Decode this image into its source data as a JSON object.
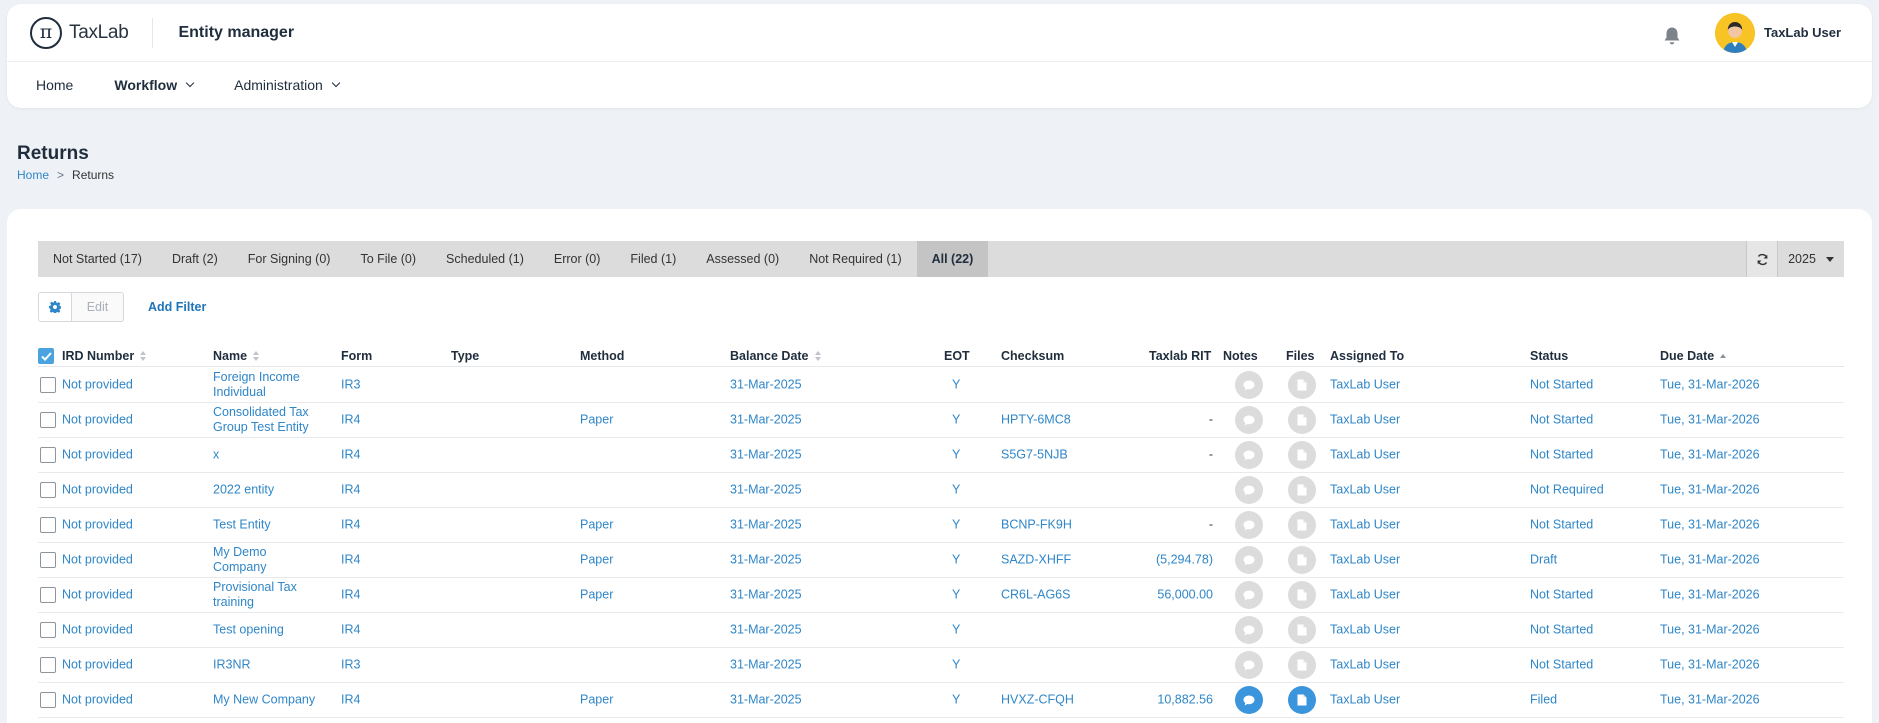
{
  "app": {
    "logo_text": "TaxLab",
    "title": "Entity manager",
    "user_name": "TaxLab User"
  },
  "nav": {
    "home": "Home",
    "workflow": "Workflow",
    "administration": "Administration"
  },
  "page": {
    "title": "Returns"
  },
  "breadcrumb": {
    "home": "Home",
    "separator": ">",
    "current": "Returns"
  },
  "tabs": [
    {
      "label": "Not Started (17)"
    },
    {
      "label": "Draft (2)"
    },
    {
      "label": "For Signing (0)"
    },
    {
      "label": "To File (0)"
    },
    {
      "label": "Scheduled (1)"
    },
    {
      "label": "Error (0)"
    },
    {
      "label": "Filed (1)"
    },
    {
      "label": "Assessed (0)"
    },
    {
      "label": "Not Required (1)"
    },
    {
      "label": "All (22)",
      "active": true
    }
  ],
  "year": "2025",
  "toolbar": {
    "edit_label": "Edit",
    "add_filter_label": "Add Filter"
  },
  "columns": {
    "ird": "IRD Number",
    "name": "Name",
    "form": "Form",
    "type": "Type",
    "method": "Method",
    "balance_date": "Balance Date",
    "eot": "EOT",
    "checksum": "Checksum",
    "rit": "Taxlab RIT",
    "notes": "Notes",
    "files": "Files",
    "assigned": "Assigned To",
    "status": "Status",
    "due": "Due Date"
  },
  "rows": [
    {
      "ird": "Not provided",
      "name": "Foreign Income Individual",
      "form": "IR3",
      "type": "",
      "method": "",
      "balance_date": "31-Mar-2025",
      "eot": "Y",
      "checksum": "",
      "rit": "",
      "assigned": "TaxLab User",
      "status": "Not Started",
      "due": "Tue, 31-Mar-2026"
    },
    {
      "ird": "Not provided",
      "name": "Consolidated Tax Group Test Entity",
      "form": "IR4",
      "type": "",
      "method": "Paper",
      "balance_date": "31-Mar-2025",
      "eot": "Y",
      "checksum": "HPTY-6MC8",
      "rit": "-",
      "assigned": "TaxLab User",
      "status": "Not Started",
      "due": "Tue, 31-Mar-2026"
    },
    {
      "ird": "Not provided",
      "name": "x",
      "form": "IR4",
      "type": "",
      "method": "",
      "balance_date": "31-Mar-2025",
      "eot": "Y",
      "checksum": "S5G7-5NJB",
      "rit": "-",
      "assigned": "TaxLab User",
      "status": "Not Started",
      "due": "Tue, 31-Mar-2026"
    },
    {
      "ird": "Not provided",
      "name": "2022 entity",
      "form": "IR4",
      "type": "",
      "method": "",
      "balance_date": "31-Mar-2025",
      "eot": "Y",
      "checksum": "",
      "rit": "",
      "assigned": "TaxLab User",
      "status": "Not Required",
      "due": "Tue, 31-Mar-2026"
    },
    {
      "ird": "Not provided",
      "name": "Test Entity",
      "form": "IR4",
      "type": "",
      "method": "Paper",
      "balance_date": "31-Mar-2025",
      "eot": "Y",
      "checksum": "BCNP-FK9H",
      "rit": "-",
      "assigned": "TaxLab User",
      "status": "Not Started",
      "due": "Tue, 31-Mar-2026"
    },
    {
      "ird": "Not provided",
      "name": "My Demo Company",
      "form": "IR4",
      "type": "",
      "method": "Paper",
      "balance_date": "31-Mar-2025",
      "eot": "Y",
      "checksum": "SAZD-XHFF",
      "rit": "(5,294.78)",
      "assigned": "TaxLab User",
      "status": "Draft",
      "due": "Tue, 31-Mar-2026"
    },
    {
      "ird": "Not provided",
      "name": "Provisional Tax training",
      "form": "IR4",
      "type": "",
      "method": "Paper",
      "balance_date": "31-Mar-2025",
      "eot": "Y",
      "checksum": "CR6L-AG6S",
      "rit": "56,000.00",
      "assigned": "TaxLab User",
      "status": "Not Started",
      "due": "Tue, 31-Mar-2026"
    },
    {
      "ird": "Not provided",
      "name": "Test opening",
      "form": "IR4",
      "type": "",
      "method": "",
      "balance_date": "31-Mar-2025",
      "eot": "Y",
      "checksum": "",
      "rit": "",
      "assigned": "TaxLab User",
      "status": "Not Started",
      "due": "Tue, 31-Mar-2026"
    },
    {
      "ird": "Not provided",
      "name": "IR3NR",
      "form": "IR3",
      "type": "",
      "method": "",
      "balance_date": "31-Mar-2025",
      "eot": "Y",
      "checksum": "",
      "rit": "",
      "assigned": "TaxLab User",
      "status": "Not Started",
      "due": "Tue, 31-Mar-2026"
    },
    {
      "ird": "Not provided",
      "name": "My New Company",
      "form": "IR4",
      "type": "",
      "method": "Paper",
      "balance_date": "31-Mar-2025",
      "eot": "Y",
      "checksum": "HVXZ-CFQH",
      "rit": "10,882.56",
      "assigned": "TaxLab User",
      "status": "Filed",
      "due": "Tue, 31-Mar-2026",
      "has_notes": true,
      "has_files": true
    }
  ],
  "colors": {
    "link": "#2f86c8",
    "accent": "#4aa3df",
    "tab_bar": "#dcdcdc",
    "tab_active": "#c4c4c4",
    "avatar_bg": "#f7c325"
  },
  "icons": [
    "bell-icon",
    "chevron-down-icon",
    "refresh-icon",
    "gear-icon",
    "sort-icon",
    "comment-icon",
    "file-icon",
    "checkbox-icon"
  ]
}
